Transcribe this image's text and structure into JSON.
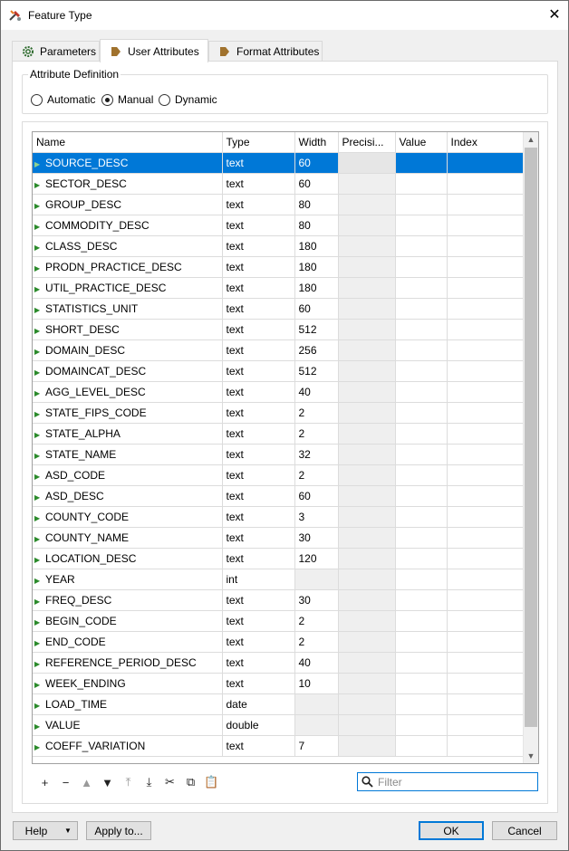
{
  "window": {
    "title": "Feature Type",
    "app_icon": "fme-tools-icon",
    "close_label": "✕"
  },
  "tabs": [
    {
      "label": "Parameters",
      "icon": "gear-icon"
    },
    {
      "label": "User Attributes",
      "icon": "tag-arrow-icon",
      "active": true
    },
    {
      "label": "Format Attributes",
      "icon": "tag-arrow-icon"
    }
  ],
  "attribute_definition": {
    "label": "Attribute Definition",
    "options": [
      "Automatic",
      "Manual",
      "Dynamic"
    ],
    "selected": "Manual"
  },
  "table": {
    "columns": [
      "Name",
      "Type",
      "Width",
      "Precisi...",
      "Value",
      "Index"
    ],
    "rows": [
      {
        "name": "SOURCE_DESC",
        "type": "text",
        "width": "60",
        "selected": true
      },
      {
        "name": "SECTOR_DESC",
        "type": "text",
        "width": "60"
      },
      {
        "name": "GROUP_DESC",
        "type": "text",
        "width": "80"
      },
      {
        "name": "COMMODITY_DESC",
        "type": "text",
        "width": "80"
      },
      {
        "name": "CLASS_DESC",
        "type": "text",
        "width": "180"
      },
      {
        "name": "PRODN_PRACTICE_DESC",
        "type": "text",
        "width": "180"
      },
      {
        "name": "UTIL_PRACTICE_DESC",
        "type": "text",
        "width": "180"
      },
      {
        "name": "STATISTICS_UNIT",
        "type": "text",
        "width": "60"
      },
      {
        "name": "SHORT_DESC",
        "type": "text",
        "width": "512"
      },
      {
        "name": "DOMAIN_DESC",
        "type": "text",
        "width": "256"
      },
      {
        "name": "DOMAINCAT_DESC",
        "type": "text",
        "width": "512"
      },
      {
        "name": "AGG_LEVEL_DESC",
        "type": "text",
        "width": "40"
      },
      {
        "name": "STATE_FIPS_CODE",
        "type": "text",
        "width": "2"
      },
      {
        "name": "STATE_ALPHA",
        "type": "text",
        "width": "2"
      },
      {
        "name": "STATE_NAME",
        "type": "text",
        "width": "32"
      },
      {
        "name": "ASD_CODE",
        "type": "text",
        "width": "2"
      },
      {
        "name": "ASD_DESC",
        "type": "text",
        "width": "60"
      },
      {
        "name": "COUNTY_CODE",
        "type": "text",
        "width": "3"
      },
      {
        "name": "COUNTY_NAME",
        "type": "text",
        "width": "30"
      },
      {
        "name": "LOCATION_DESC",
        "type": "text",
        "width": "120"
      },
      {
        "name": "YEAR",
        "type": "int",
        "width": ""
      },
      {
        "name": "FREQ_DESC",
        "type": "text",
        "width": "30"
      },
      {
        "name": "BEGIN_CODE",
        "type": "text",
        "width": "2"
      },
      {
        "name": "END_CODE",
        "type": "text",
        "width": "2"
      },
      {
        "name": "REFERENCE_PERIOD_DESC",
        "type": "text",
        "width": "40"
      },
      {
        "name": "WEEK_ENDING",
        "type": "text",
        "width": "10"
      },
      {
        "name": "LOAD_TIME",
        "type": "date",
        "width": ""
      },
      {
        "name": "VALUE",
        "type": "double",
        "width": ""
      },
      {
        "name": "COEFF_VARIATION",
        "type": "text",
        "width": "7"
      }
    ]
  },
  "toolbar": {
    "buttons": [
      {
        "name": "add-row-button",
        "glyph": "+",
        "enabled": true
      },
      {
        "name": "remove-row-button",
        "glyph": "−",
        "enabled": true
      },
      {
        "name": "move-up-button",
        "glyph": "▲",
        "enabled": false
      },
      {
        "name": "move-down-button",
        "glyph": "▼",
        "enabled": true
      },
      {
        "name": "move-top-button",
        "glyph": "⤒",
        "enabled": false
      },
      {
        "name": "move-bottom-button",
        "glyph": "⤓",
        "enabled": true
      },
      {
        "name": "cut-button",
        "glyph": "✂",
        "enabled": true
      },
      {
        "name": "copy-button",
        "glyph": "⧉",
        "enabled": true
      },
      {
        "name": "paste-button",
        "glyph": "📋",
        "enabled": false
      }
    ]
  },
  "filter": {
    "placeholder": "Filter",
    "value": ""
  },
  "footer": {
    "help_label": "Help",
    "apply_label": "Apply to...",
    "ok_label": "OK",
    "cancel_label": "Cancel"
  },
  "colors": {
    "selection": "#0078d7",
    "arrow": "#2a8a2a"
  }
}
